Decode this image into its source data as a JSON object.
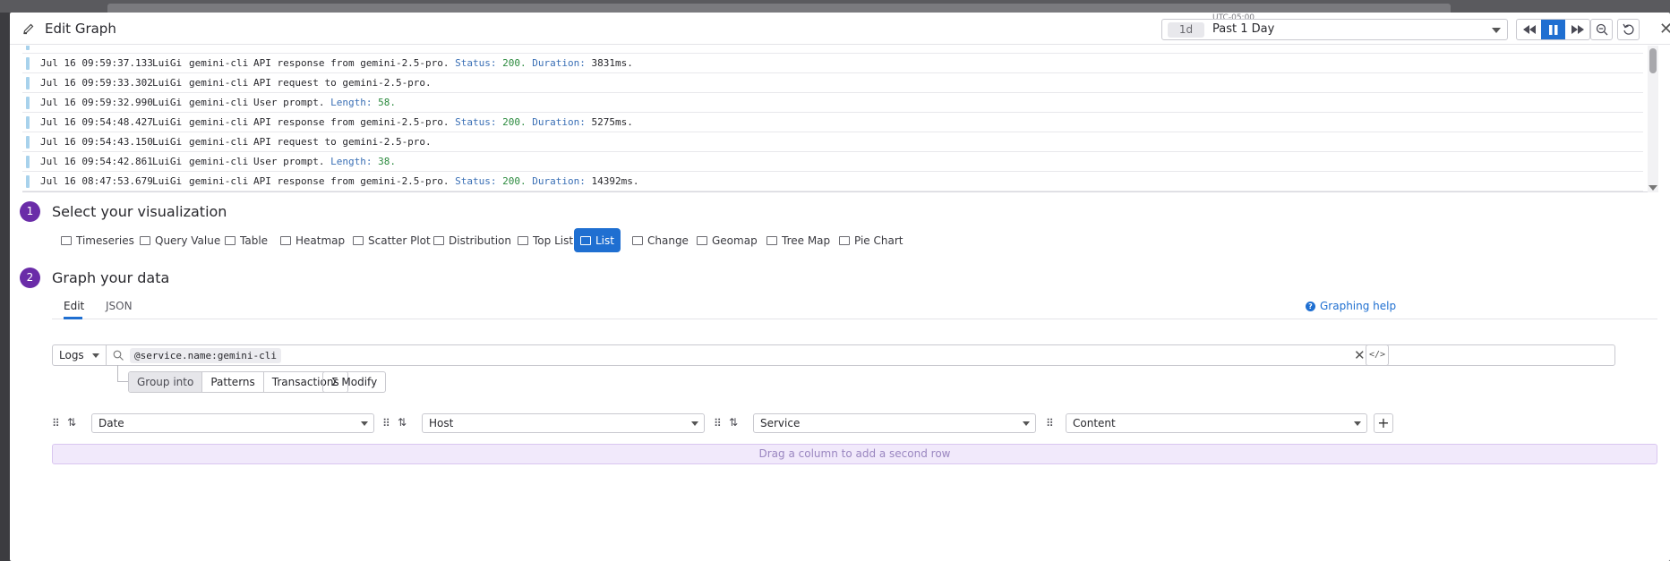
{
  "header": {
    "title": "Edit Graph",
    "timezone": "UTC-05:00",
    "time_badge": "1d",
    "time_value": "Past 1 Day"
  },
  "logs": [
    {
      "date": "Jul 16 09:59:37.133",
      "host": "LuiGi",
      "service": "gemini-cli",
      "msg": "API response from gemini-2.5-pro.",
      "status_label": "Status:",
      "status": "200.",
      "dur_label": "Duration:",
      "dur": "3831ms."
    },
    {
      "date": "Jul 16 09:59:33.302",
      "host": "LuiGi",
      "service": "gemini-cli",
      "msg": "API request to gemini-2.5-pro."
    },
    {
      "date": "Jul 16 09:59:32.990",
      "host": "LuiGi",
      "service": "gemini-cli",
      "msg": "User prompt.",
      "len_label": "Length:",
      "len": "58."
    },
    {
      "date": "Jul 16 09:54:48.427",
      "host": "LuiGi",
      "service": "gemini-cli",
      "msg": "API response from gemini-2.5-pro.",
      "status_label": "Status:",
      "status": "200.",
      "dur_label": "Duration:",
      "dur": "5275ms."
    },
    {
      "date": "Jul 16 09:54:43.150",
      "host": "LuiGi",
      "service": "gemini-cli",
      "msg": "API request to gemini-2.5-pro."
    },
    {
      "date": "Jul 16 09:54:42.861",
      "host": "LuiGi",
      "service": "gemini-cli",
      "msg": "User prompt.",
      "len_label": "Length:",
      "len": "38."
    },
    {
      "date": "Jul 16 08:47:53.679",
      "host": "LuiGi",
      "service": "gemini-cli",
      "msg": "API response from gemini-2.5-pro.",
      "status_label": "Status:",
      "status": "200.",
      "dur_label": "Duration:",
      "dur": "14392ms."
    }
  ],
  "step1": {
    "num": "1",
    "title": "Select your visualization"
  },
  "visualizations": [
    "Timeseries",
    "Query Value",
    "Table",
    "Heatmap",
    "Scatter Plot",
    "Distribution",
    "Top List",
    "List",
    "Change",
    "Geomap",
    "Tree Map",
    "Pie Chart"
  ],
  "selected_visualization": "List",
  "step2": {
    "num": "2",
    "title": "Graph your data"
  },
  "tabs": {
    "edit": "Edit",
    "json": "JSON"
  },
  "help_link": "Graphing help",
  "query": {
    "source": "Logs",
    "filter": "@service.name:gemini-cli"
  },
  "group_options": [
    "Group into",
    "Patterns",
    "Transactions"
  ],
  "modify_label": "Modify",
  "columns": [
    "Date",
    "Host",
    "Service",
    "Content"
  ],
  "dropzone_text": "Drag a column to add a second row",
  "colors": {
    "accent": "#1f6fd1",
    "step": "#6a2ca8",
    "status_bar": "#a8d2ec"
  }
}
